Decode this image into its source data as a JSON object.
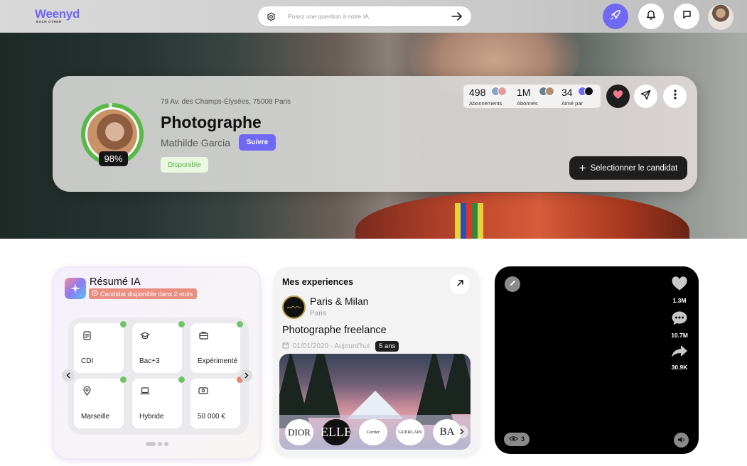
{
  "header": {
    "logo": "Weenyd",
    "logo_tagline": "EACH OTHER",
    "search_placeholder": "Posez une question à notre IA"
  },
  "colors": {
    "brand": "#6f68f3",
    "available": "#58b947",
    "dark": "#1e1e1e"
  },
  "profile": {
    "address": "79 Av. des Champs-Élysées, 75008 Paris",
    "title": "Photographe",
    "name": "Mathilde Garcia",
    "follow_label": "Suivre",
    "status": "Disponible",
    "completion": "98%",
    "completion_value": 0.98,
    "stats": [
      {
        "value": "498",
        "label": "Abonnements"
      },
      {
        "value": "1M",
        "label": "Abonnés"
      },
      {
        "value": "34",
        "label": "Aimé par"
      }
    ],
    "select_label": "Selectionner  le candidat"
  },
  "ai_summary": {
    "title": "Résumé IA",
    "availability": "Candidat disponible dans 2 mois",
    "tiles": [
      {
        "label": "CDI",
        "icon": "document-icon",
        "status": "green"
      },
      {
        "label": "Bac+3",
        "icon": "graduation-cap-icon",
        "status": "green"
      },
      {
        "label": "Expérimenté",
        "icon": "briefcase-icon",
        "status": "green"
      },
      {
        "label": "Marseille",
        "icon": "location-pin-icon",
        "status": "green"
      },
      {
        "label": "Hybride",
        "icon": "laptop-icon",
        "status": "green"
      },
      {
        "label": "50 000 €",
        "icon": "money-icon",
        "status": "red"
      }
    ]
  },
  "experiences": {
    "title": "Mes experiences",
    "company": "Paris & Milan",
    "location": "Paris",
    "role": "Photographe freelance",
    "dates": "01/01/2020 - Aujourd'hui",
    "duration": "5 ans",
    "brands": [
      "DIOR",
      "ELLE",
      "Cartier",
      "GUERLAIN",
      "BA"
    ]
  },
  "video": {
    "likes": "1.3M",
    "comments": "10.7M",
    "shares": "30.9K",
    "views": "3"
  }
}
